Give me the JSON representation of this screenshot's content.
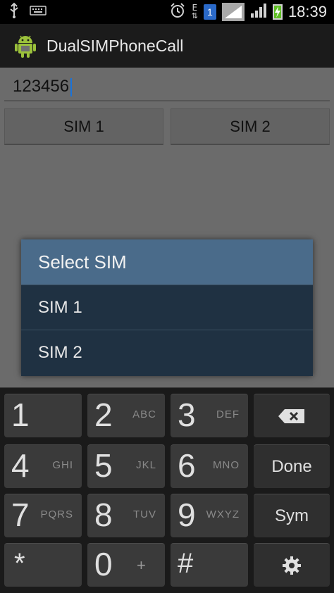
{
  "status_bar": {
    "time": "18:39",
    "network_type": "E",
    "sim_badge": "1",
    "icons": [
      "usb-icon",
      "keyboard-icon",
      "alarm-icon",
      "data-arrows-icon",
      "sim1-icon",
      "signal-sim1-icon",
      "signal-sim2-icon",
      "battery-charging-icon"
    ]
  },
  "app": {
    "title": "DualSIMPhoneCall",
    "icon": "android-robot-icon"
  },
  "main": {
    "phone_input_value": "123456",
    "sim1_button": "SIM 1",
    "sim2_button": "SIM 2"
  },
  "dialog": {
    "title": "Select SIM",
    "items": [
      "SIM 1",
      "SIM 2"
    ],
    "title_bg": "#4a6b8a",
    "body_bg": "#1f3142"
  },
  "keyboard": {
    "rows": [
      [
        {
          "num": "1",
          "letters": ""
        },
        {
          "num": "2",
          "letters": "ABC"
        },
        {
          "num": "3",
          "letters": "DEF"
        },
        {
          "fn": "backspace-icon"
        }
      ],
      [
        {
          "num": "4",
          "letters": "GHI"
        },
        {
          "num": "5",
          "letters": "JKL"
        },
        {
          "num": "6",
          "letters": "MNO"
        },
        {
          "label": "Done"
        }
      ],
      [
        {
          "num": "7",
          "letters": "PQRS"
        },
        {
          "num": "8",
          "letters": "TUV"
        },
        {
          "num": "9",
          "letters": "WXYZ"
        },
        {
          "label": "Sym"
        }
      ],
      [
        {
          "num": "*",
          "letters": ""
        },
        {
          "num": "0",
          "letters": "+"
        },
        {
          "num": "#",
          "letters": ""
        },
        {
          "fn": "gear-icon"
        }
      ]
    ],
    "done_label": "Done",
    "sym_label": "Sym",
    "zero_sub": "+"
  }
}
